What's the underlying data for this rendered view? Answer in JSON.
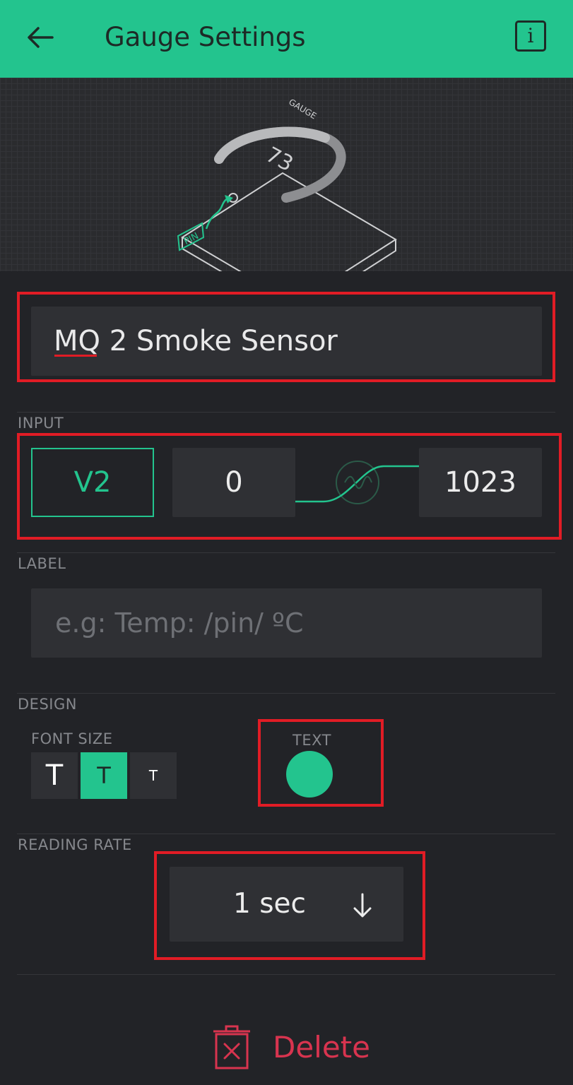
{
  "header": {
    "title": "Gauge Settings",
    "back_icon": "arrow-left-icon",
    "info_icon": "info-icon",
    "info_glyph": "i",
    "bg_color": "#23c48e"
  },
  "preview": {
    "widget_caption": "GAUGE",
    "gauge_value": "73",
    "pin_caption": "PIN"
  },
  "name_field": {
    "value": "MQ 2 Smoke Sensor"
  },
  "input": {
    "section_label": "INPUT",
    "pin": "V2",
    "min": "0",
    "max": "1023",
    "mapping_icon": "curve-mapping-icon"
  },
  "label": {
    "section_label": "LABEL",
    "placeholder": "e.g: Temp: /pin/ ºC"
  },
  "design": {
    "section_label": "DESIGN",
    "font_size_label": "FONT SIZE",
    "font_sizes": [
      "T",
      "T",
      "T"
    ],
    "selected_font_size_index": 1,
    "text_color_label": "TEXT",
    "text_color": "#23c48e"
  },
  "reading_rate": {
    "section_label": "READING RATE",
    "value": "1 sec",
    "dropdown_icon": "arrow-down-icon"
  },
  "delete": {
    "label": "Delete",
    "icon": "trash-icon",
    "color": "#d8344f"
  },
  "highlight_color": "#e11c25"
}
